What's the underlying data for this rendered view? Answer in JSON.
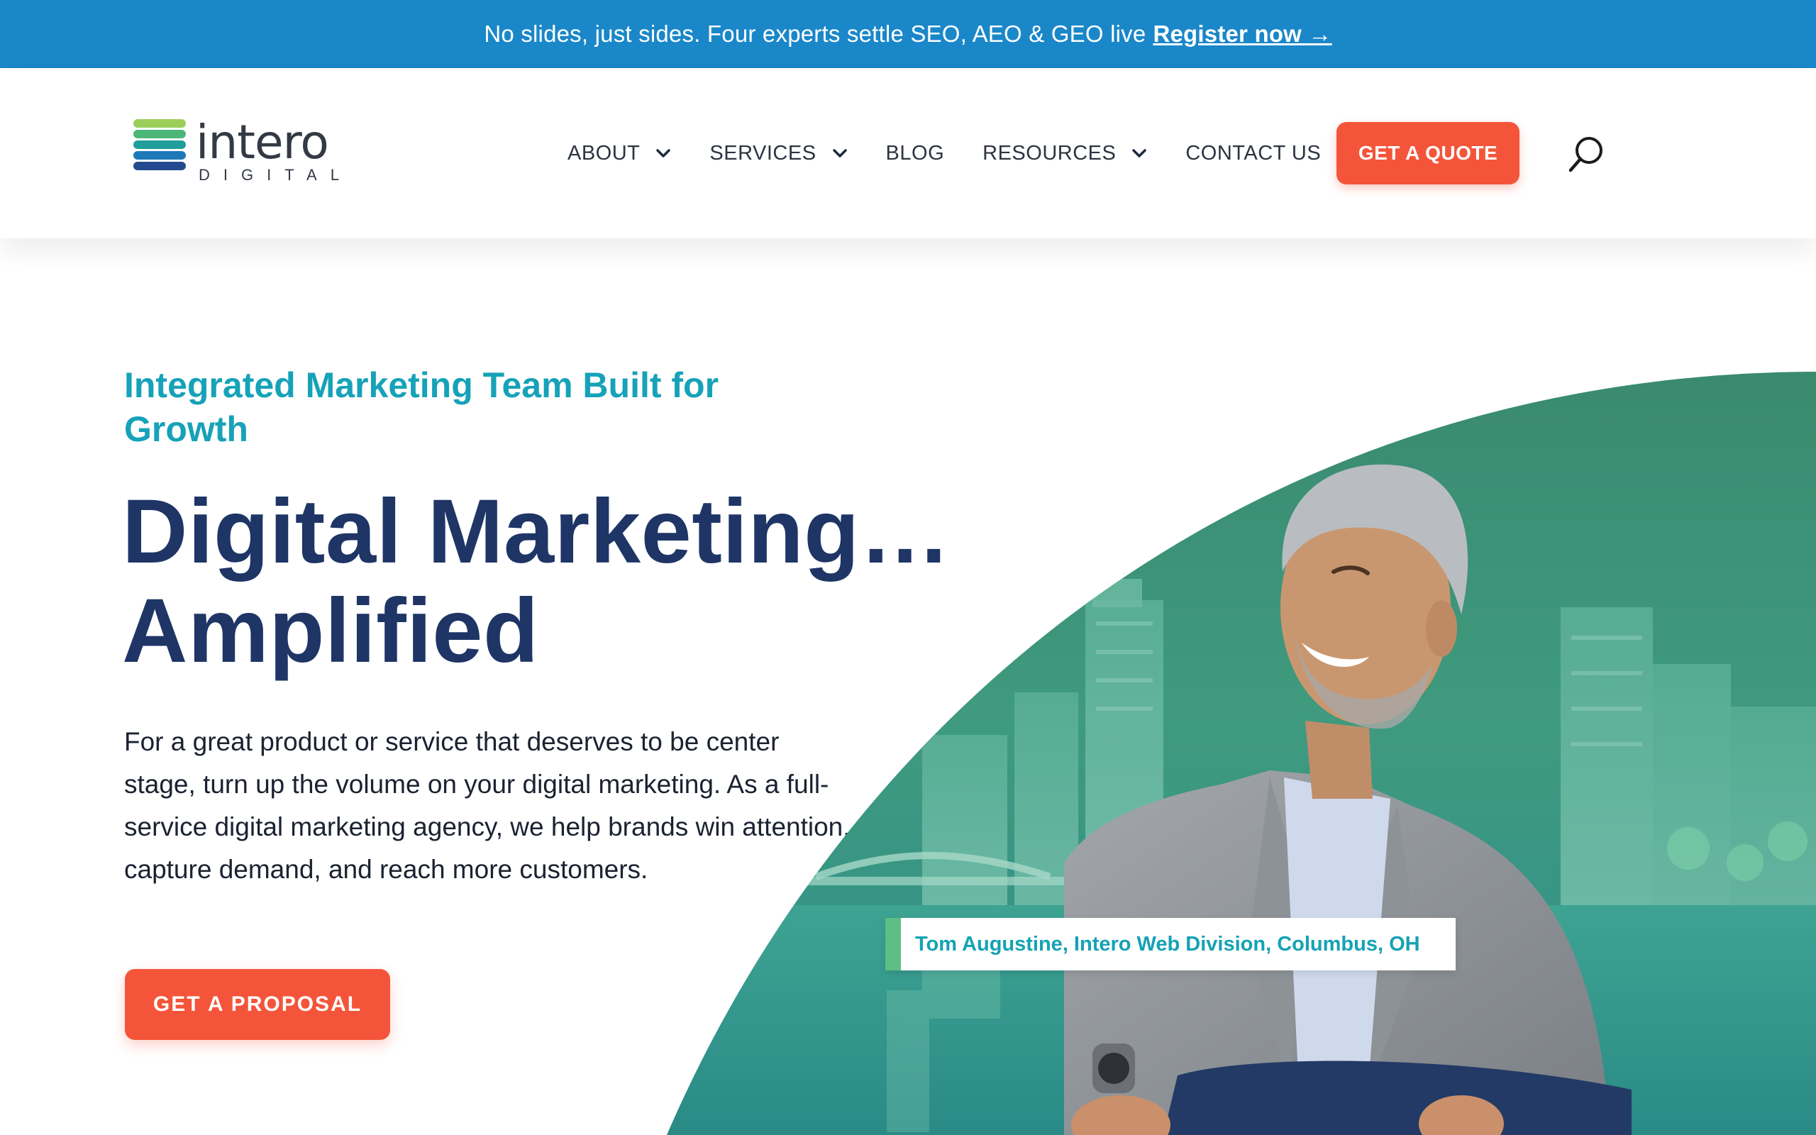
{
  "announcement": {
    "text": "No slides, just sides. Four experts settle SEO, AEO & GEO live",
    "link_label": "Register now →"
  },
  "brand": {
    "name": "intero",
    "sub": "DIGITAL",
    "stripe_colors": [
      "#9ccf5a",
      "#4ab778",
      "#1f9e9a",
      "#1d79b8",
      "#234a8e"
    ]
  },
  "nav": {
    "items": [
      {
        "label": "ABOUT",
        "dropdown": true
      },
      {
        "label": "SERVICES",
        "dropdown": true
      },
      {
        "label": "BLOG",
        "dropdown": false
      },
      {
        "label": "RESOURCES",
        "dropdown": true
      },
      {
        "label": "CONTACT US",
        "dropdown": false
      }
    ],
    "cta_label": "GET A QUOTE",
    "search_icon": "search-icon"
  },
  "hero": {
    "eyebrow": "Integrated Marketing Team Built for Growth",
    "headline_line1": "Digital Marketing…",
    "headline_line2": "Amplified",
    "lead": "For a great product or service that deserves to be center stage, turn up the volume on your digital marketing. As a full-service digital marketing agency, we help brands win attention, capture demand, and reach more customers.",
    "cta_label": "GET A PROPOSAL",
    "caption": "Tom Augustine, Intero Web Division, Columbus, OH"
  },
  "colors": {
    "announce_bg": "#1a87c9",
    "accent_orange": "#f4553a",
    "teal": "#16a2b8",
    "navy": "#1e3566",
    "arc_green": "#3e8d73"
  }
}
